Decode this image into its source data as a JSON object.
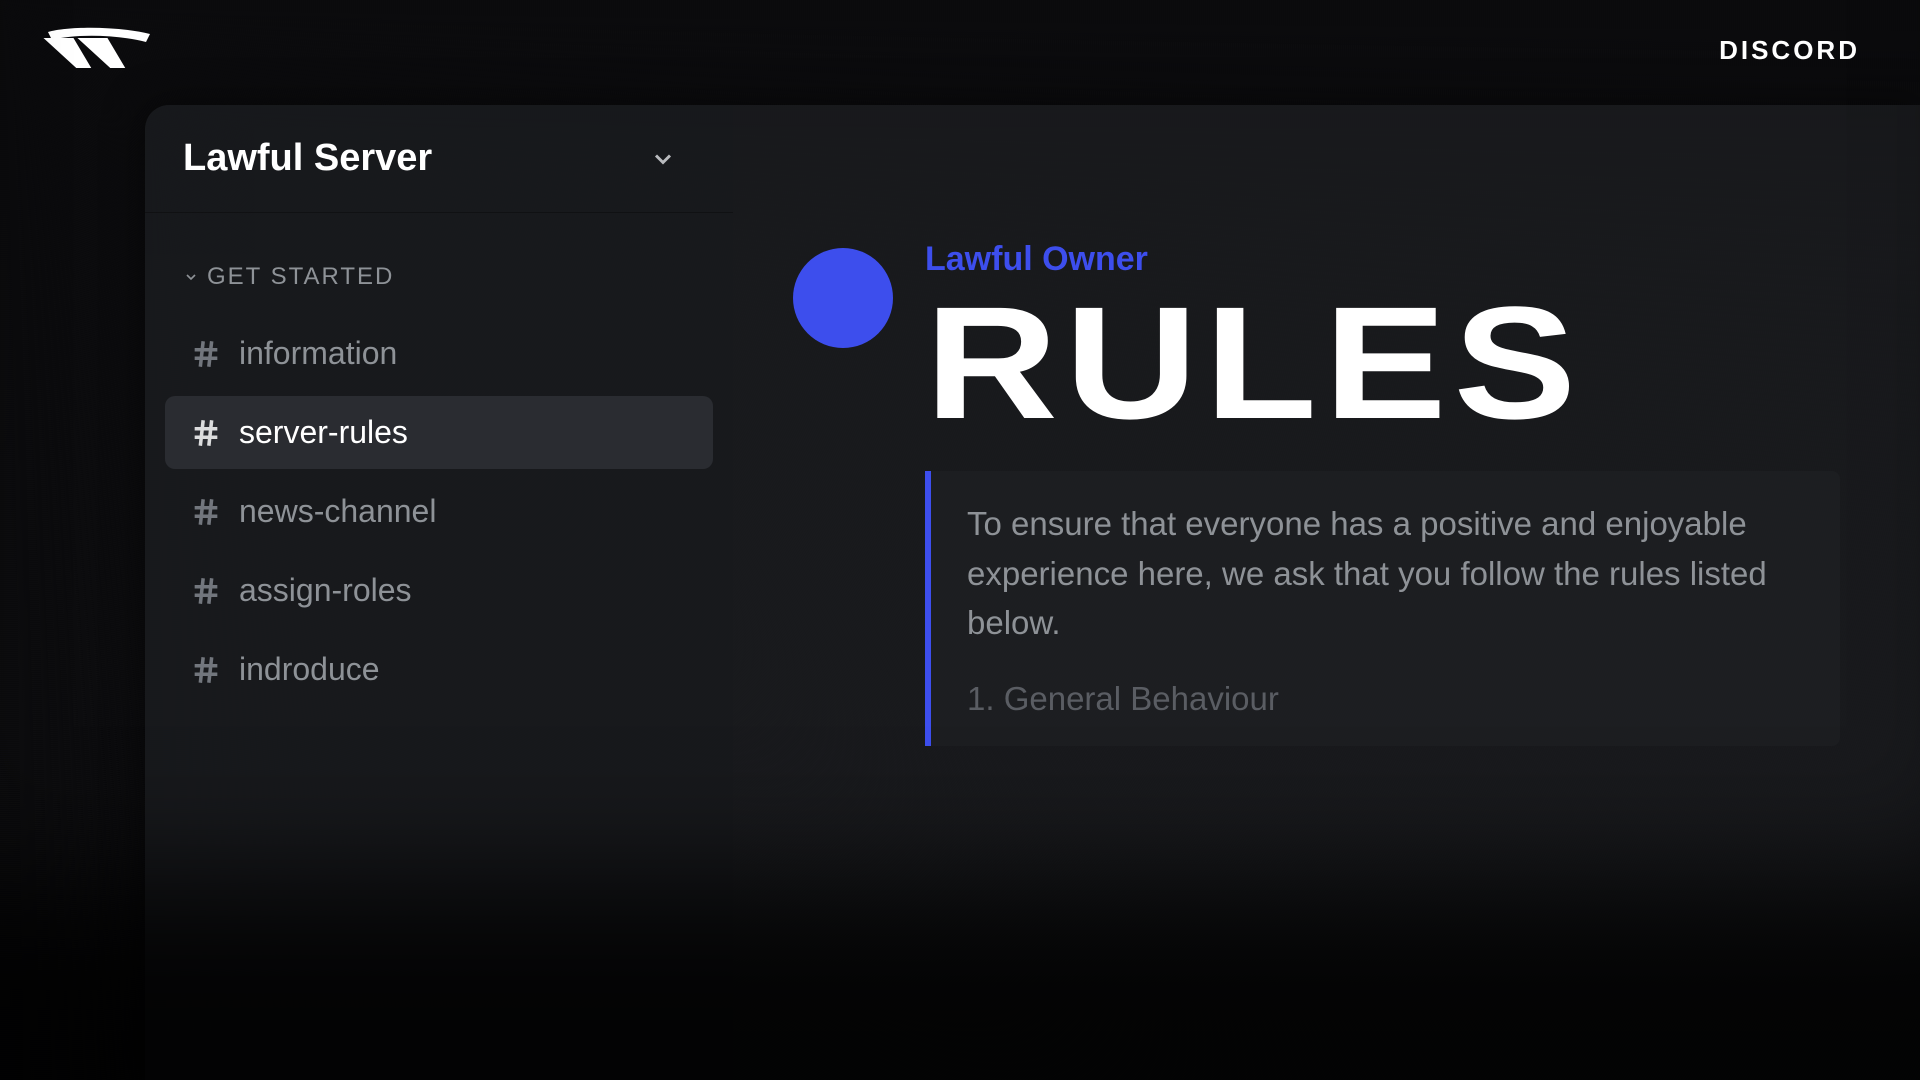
{
  "brand": "DISCORD",
  "server": {
    "name": "Lawful Server"
  },
  "sidebar": {
    "category": "GET STARTED",
    "channels": [
      {
        "name": "information",
        "active": false
      },
      {
        "name": "server-rules",
        "active": true
      },
      {
        "name": "news-channel",
        "active": false
      },
      {
        "name": "assign-roles",
        "active": false
      },
      {
        "name": "indroduce",
        "active": false
      }
    ]
  },
  "message": {
    "author": "Lawful Owner",
    "title": "RULES",
    "embed": {
      "intro": "To ensure that everyone has a positive and enjoyable experience here, we ask that you follow the rules listed below.",
      "section1": "1. General Behaviour"
    }
  },
  "colors": {
    "accent": "#3d4eed"
  }
}
